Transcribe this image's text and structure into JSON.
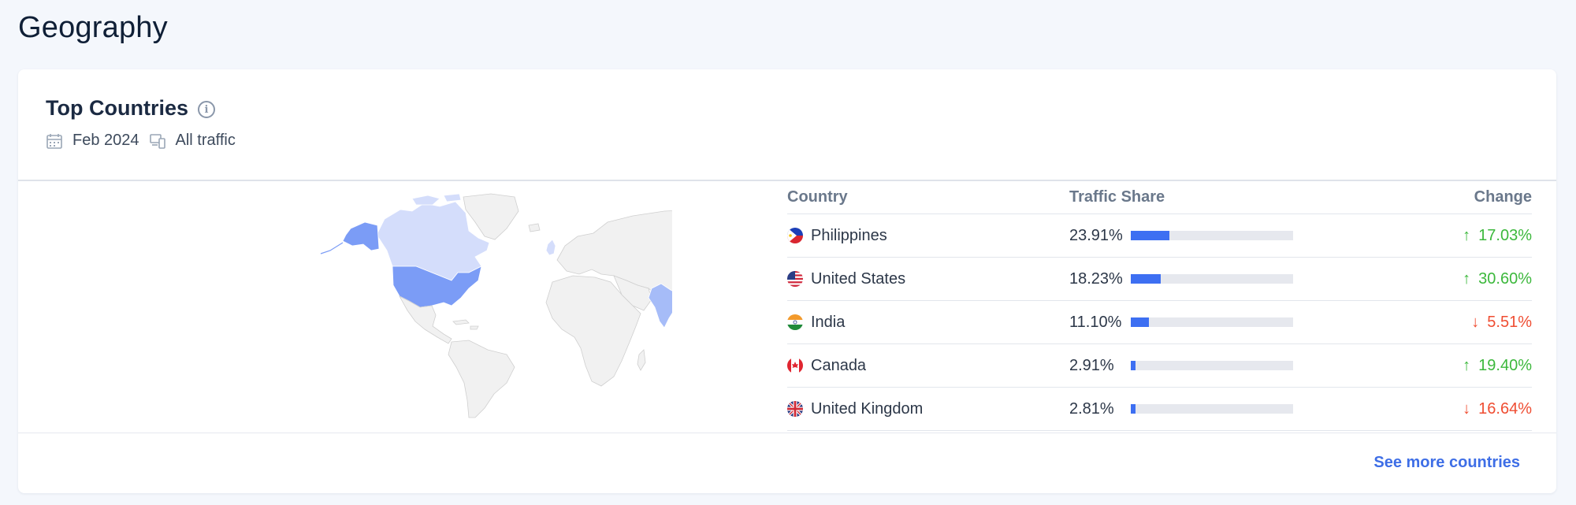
{
  "page": {
    "title": "Geography"
  },
  "card": {
    "title": "Top Countries",
    "info_icon": "info-icon",
    "date": "Feb 2024",
    "traffic": "All traffic",
    "see_more": "See more countries"
  },
  "table": {
    "headers": {
      "country": "Country",
      "share": "Traffic Share",
      "change": "Change"
    },
    "rows": [
      {
        "country": "Philippines",
        "share": "23.91%",
        "share_value": 0.2391,
        "change": "17.03%",
        "direction": "up"
      },
      {
        "country": "United States",
        "share": "18.23%",
        "share_value": 0.1823,
        "change": "30.60%",
        "direction": "up"
      },
      {
        "country": "India",
        "share": "11.10%",
        "share_value": 0.111,
        "change": "5.51%",
        "direction": "down"
      },
      {
        "country": "Canada",
        "share": "2.91%",
        "share_value": 0.0291,
        "change": "19.40%",
        "direction": "up"
      },
      {
        "country": "United Kingdom",
        "share": "2.81%",
        "share_value": 0.0281,
        "change": "16.64%",
        "direction": "down"
      }
    ]
  },
  "colors": {
    "accent": "#3d6ff2",
    "up": "#3cb83c",
    "down": "#ef4d32",
    "map_base": "#f1f1f1",
    "map_strong": "#7b9cf6",
    "map_light": "#d4ddfb"
  }
}
